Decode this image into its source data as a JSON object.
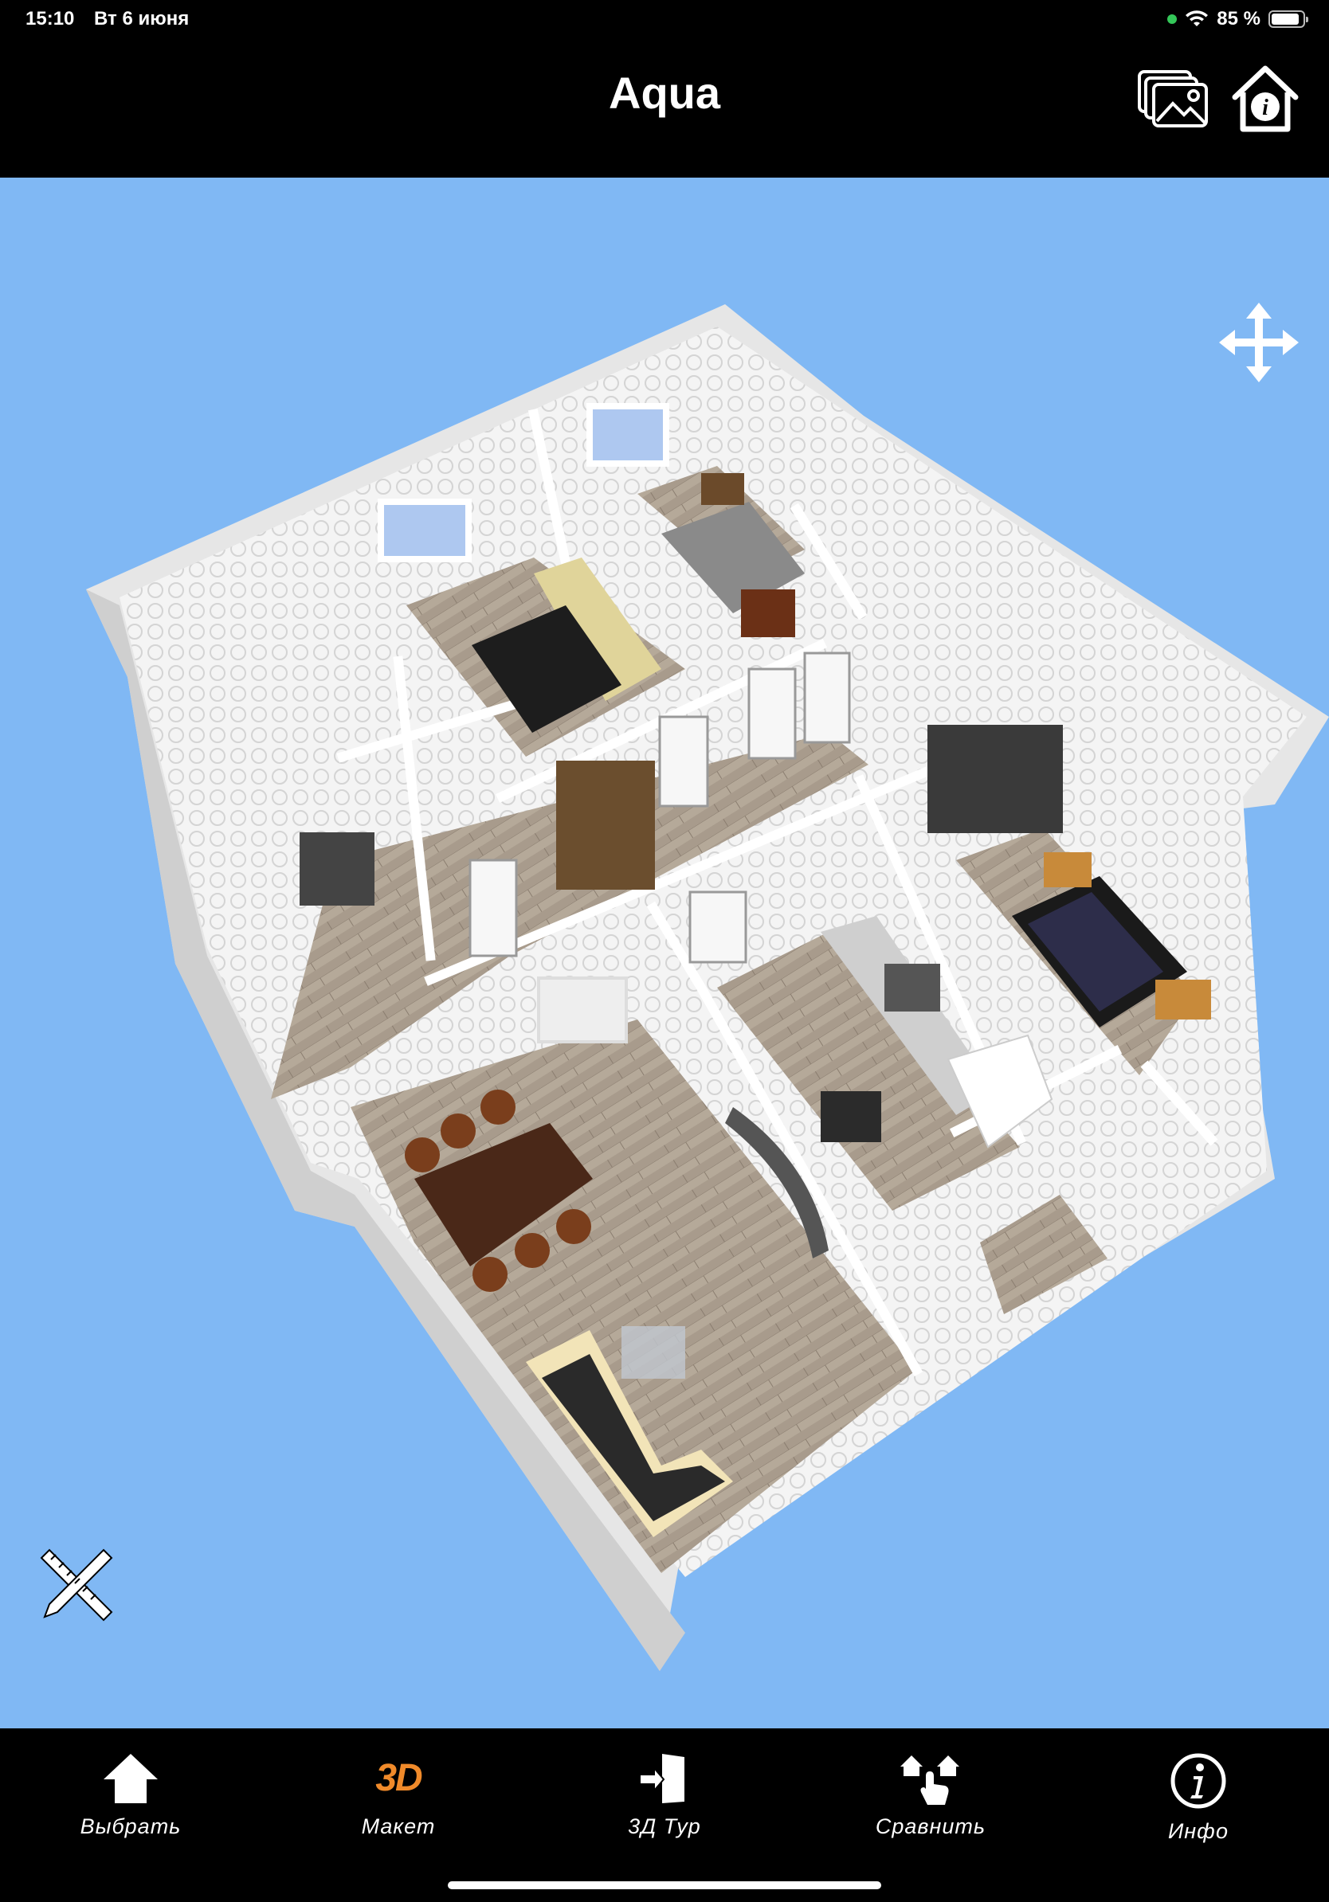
{
  "status_bar": {
    "time": "15:10",
    "date": "Вт 6 июня",
    "battery": "85 %"
  },
  "header": {
    "title": "Aqua",
    "gallery_icon": "gallery-icon",
    "house_info_icon": "house-info-icon"
  },
  "viewport": {
    "background": "#80b8f4",
    "move_icon": "move-arrows-icon",
    "tools_icon": "ruler-pencil-icon"
  },
  "tabbar": {
    "accent": "#f08a2a",
    "tabs": [
      {
        "label": "Выбрать",
        "icon": "home-arrow-icon"
      },
      {
        "label": "Макет",
        "icon": "3d-icon",
        "badge": "3D",
        "active": true
      },
      {
        "label": "3Д Тур",
        "icon": "door-enter-icon"
      },
      {
        "label": "Сравнить",
        "icon": "compare-houses-icon"
      },
      {
        "label": "Инфо",
        "icon": "info-icon"
      }
    ]
  }
}
